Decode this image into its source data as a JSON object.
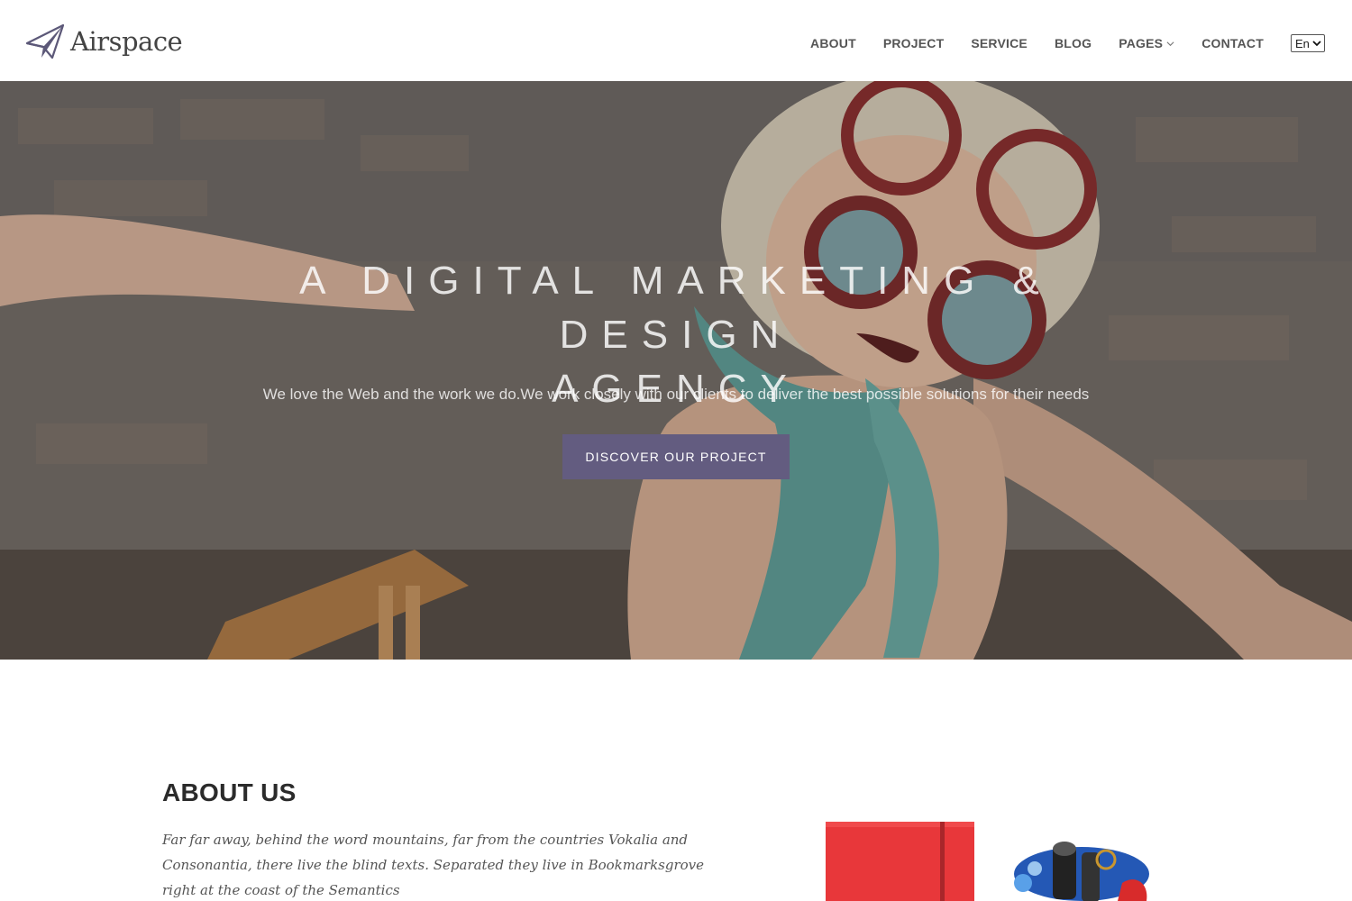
{
  "brand": {
    "name": "Airspace",
    "logo_icon": "paper-plane-icon",
    "accent": "#635c80"
  },
  "nav": {
    "items": [
      {
        "label": "ABOUT"
      },
      {
        "label": "PROJECT"
      },
      {
        "label": "SERVICE"
      },
      {
        "label": "BLOG"
      },
      {
        "label": "PAGES",
        "icon": "chevron-down-icon"
      },
      {
        "label": "CONTACT"
      }
    ],
    "language": {
      "selected": "En"
    }
  },
  "hero": {
    "title_line1": "A DIGITAL MARKETING & DESIGN",
    "title_line2": "AGENCY",
    "subtitle": "We love the Web and the work we do.We work closely with our clients to deliver the best possible solutions for their needs",
    "cta_label": "DISCOVER OUR PROJECT"
  },
  "about": {
    "heading": "ABOUT US",
    "body": "Far far away, behind the word mountains, far from the countries Vokalia and Consonantia, there live the blind texts. Separated they live in Bookmarksgrove right at the coast of the Semantics"
  }
}
